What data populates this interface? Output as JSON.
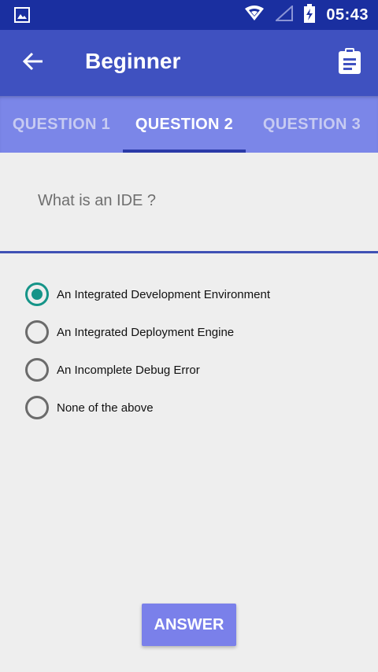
{
  "status_bar": {
    "time": "05:43",
    "icons": [
      "image-notification-icon",
      "wifi-icon",
      "signal-icon",
      "battery-charging-icon"
    ]
  },
  "toolbar": {
    "title": "Beginner",
    "back_icon": "arrow-back-icon",
    "action_icon": "clipboard-icon",
    "background": "#3f51c0"
  },
  "tabs": [
    {
      "label": "QUESTION 1",
      "active": false
    },
    {
      "label": "QUESTION 2",
      "active": true
    },
    {
      "label": "QUESTION 3",
      "active": false
    }
  ],
  "question": {
    "text": "What is an IDE ?"
  },
  "options": [
    {
      "label": "An Integrated Development Environment",
      "selected": true
    },
    {
      "label": "An Integrated Deployment Engine",
      "selected": false
    },
    {
      "label": "An Incomplete Debug Error",
      "selected": false
    },
    {
      "label": "None of the above",
      "selected": false
    }
  ],
  "answer_button": {
    "label": "ANSWER"
  },
  "colors": {
    "status_bar": "#1a2fa0",
    "tab_bar": "#7b86e8",
    "accent_radio": "#159488",
    "button": "#7a80ea"
  }
}
